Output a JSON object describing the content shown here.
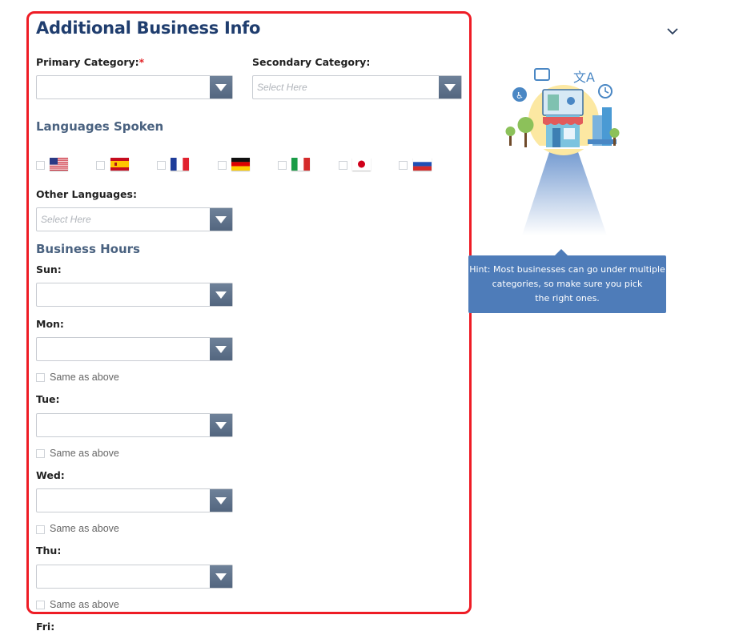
{
  "form": {
    "title": "Additional Business Info",
    "primary_category_label": "Primary Category:",
    "required_mark": "*",
    "secondary_category_label": "Secondary Category:",
    "secondary_placeholder": "Select Here",
    "languages_heading": "Languages Spoken",
    "languages": [
      {
        "name": "English",
        "icon": "us-flag-icon",
        "checked": false
      },
      {
        "name": "Spanish",
        "icon": "spain-flag-icon",
        "checked": false
      },
      {
        "name": "French",
        "icon": "france-flag-icon",
        "checked": false
      },
      {
        "name": "German",
        "icon": "germany-flag-icon",
        "checked": false
      },
      {
        "name": "Italian",
        "icon": "italy-flag-icon",
        "checked": false
      },
      {
        "name": "Japanese",
        "icon": "japan-flag-icon",
        "checked": false
      },
      {
        "name": "Russian",
        "icon": "russia-flag-icon",
        "checked": false
      }
    ],
    "other_languages_label": "Other Languages:",
    "other_languages_placeholder": "Select Here",
    "hours_heading": "Business Hours",
    "days": {
      "sun": "Sun:",
      "mon": "Mon:",
      "tue": "Tue:",
      "wed": "Wed:",
      "thu": "Thu:",
      "fri": "Fri:"
    },
    "same_as_above": "Same as above"
  },
  "hint": {
    "line1": "Hint: Most businesses can go under multiple",
    "line2": "categories, so make sure you pick",
    "line3": "the right ones."
  },
  "colors": {
    "frame": "#ee1c25",
    "title": "#1f3d6e",
    "section": "#4a6280",
    "select_button": "#5b6e86",
    "hint_bg": "#4e7cb9"
  }
}
